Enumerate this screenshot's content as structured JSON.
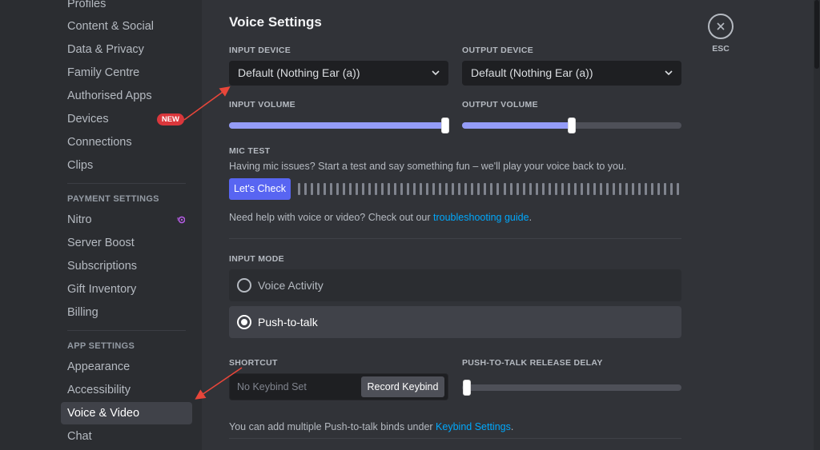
{
  "sidebar": {
    "user_settings_items": [
      {
        "label": "Profiles"
      },
      {
        "label": "Content & Social"
      },
      {
        "label": "Data & Privacy"
      },
      {
        "label": "Family Centre"
      },
      {
        "label": "Authorised Apps"
      },
      {
        "label": "Devices",
        "badge": "NEW"
      },
      {
        "label": "Connections"
      },
      {
        "label": "Clips"
      }
    ],
    "payment_header": "PAYMENT SETTINGS",
    "payment_items": [
      {
        "label": "Nitro",
        "icon": "nitro-icon"
      },
      {
        "label": "Server Boost"
      },
      {
        "label": "Subscriptions"
      },
      {
        "label": "Gift Inventory"
      },
      {
        "label": "Billing"
      }
    ],
    "app_header": "APP SETTINGS",
    "app_items": [
      {
        "label": "Appearance"
      },
      {
        "label": "Accessibility"
      },
      {
        "label": "Voice & Video",
        "active": true
      },
      {
        "label": "Chat"
      }
    ]
  },
  "main": {
    "title": "Voice Settings",
    "input_device": {
      "label": "INPUT DEVICE",
      "value": "Default (Nothing Ear (a))"
    },
    "output_device": {
      "label": "OUTPUT DEVICE",
      "value": "Default (Nothing Ear (a))"
    },
    "input_volume": {
      "label": "INPUT VOLUME",
      "percent": 100
    },
    "output_volume": {
      "label": "OUTPUT VOLUME",
      "percent": 50
    },
    "mic_test": {
      "label": "MIC TEST",
      "description": "Having mic issues? Start a test and say something fun – we'll play your voice back to you.",
      "button": "Let's Check",
      "meter_bars": 60
    },
    "help": {
      "prefix": "Need help with voice or video? Check out our ",
      "link": "troubleshooting guide",
      "suffix": "."
    },
    "input_mode": {
      "label": "INPUT MODE",
      "options": [
        {
          "label": "Voice Activity",
          "selected": false
        },
        {
          "label": "Push-to-talk",
          "selected": true
        }
      ]
    },
    "shortcut": {
      "label": "SHORTCUT",
      "value": "No Keybind Set",
      "button": "Record Keybind"
    },
    "release_delay": {
      "label": "PUSH-TO-TALK RELEASE DELAY",
      "percent": 0
    },
    "keybind_note": {
      "prefix": "You can add multiple Push-to-talk binds under ",
      "link": "Keybind Settings",
      "suffix": "."
    },
    "close": {
      "label": "ESC"
    }
  },
  "colors": {
    "accent": "#5865f2",
    "slider_fill": "#949cf7",
    "badge": "#da373c",
    "link": "#00a8fc",
    "annotation_arrow": "#e8463a"
  }
}
